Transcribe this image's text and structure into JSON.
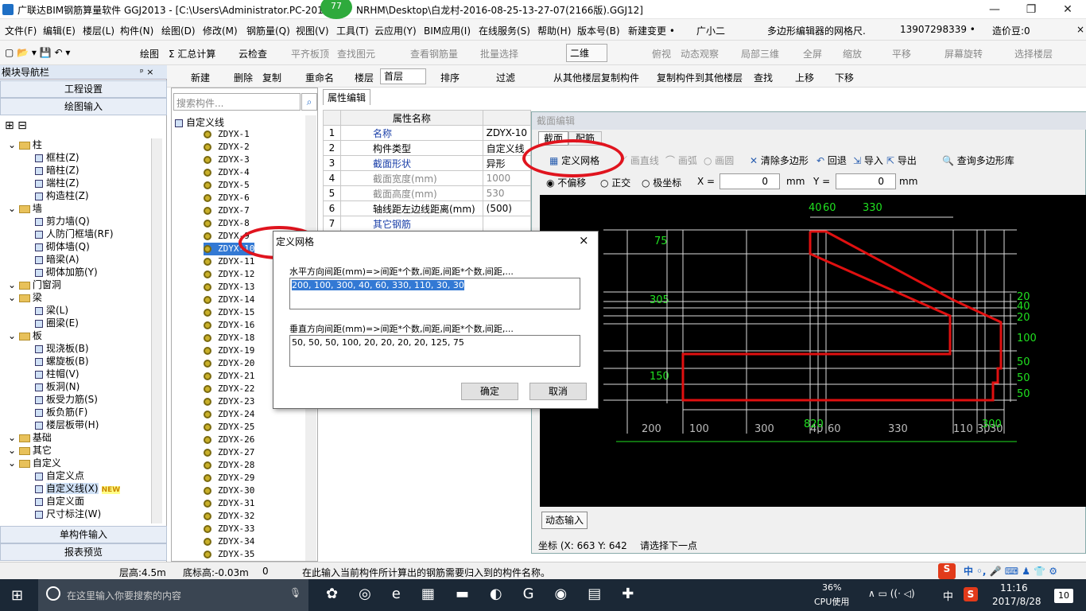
{
  "window": {
    "title": "广联达BIM钢筋算量软件 GGJ2013 - [C:\\Users\\Administrator.PC-201",
    "title_rest": "NRHM\\Desktop\\白龙村-2016-08-25-13-27-07(2166版).GGJ12]",
    "badge": "77"
  },
  "menu": [
    "文件(F)",
    "编辑(E)",
    "楼层(L)",
    "构件(N)",
    "绘图(D)",
    "修改(M)",
    "钢筋量(Q)",
    "视图(V)",
    "工具(T)",
    "云应用(Y)",
    "BIM应用(I)",
    "在线服务(S)",
    "帮助(H)",
    "版本号(B)",
    "新建变更 •",
    "广小二",
    "多边形编辑器的网格尺.",
    "13907298339 •",
    "造价豆:0"
  ],
  "toolbar1": [
    "绘图",
    "Σ 汇总计算",
    "云检查",
    "平齐板顶",
    "查找图元",
    "查看钢筋量",
    "批量选择",
    "二维",
    "俯视",
    "动态观察",
    "局部三维",
    "全屏",
    "缩放",
    "平移",
    "屏幕旋转",
    "选择楼层"
  ],
  "toolbar2": [
    "新建",
    "删除",
    "复制",
    "重命名",
    "楼层",
    "首层",
    "排序",
    "过滤",
    "从其他楼层复制构件",
    "复制构件到其他楼层",
    "查找",
    "上移",
    "下移"
  ],
  "nav": {
    "title": "模块导航栏",
    "pin": "ᵖ ×",
    "top_buttons": [
      "工程设置",
      "绘图输入"
    ],
    "bottom_buttons": [
      "单构件输入",
      "报表预览"
    ],
    "tree": [
      {
        "label": "柱",
        "level": 0,
        "type": "folder"
      },
      {
        "label": "框柱(Z)",
        "level": 1
      },
      {
        "label": "暗柱(Z)",
        "level": 1
      },
      {
        "label": "端柱(Z)",
        "level": 1
      },
      {
        "label": "构造柱(Z)",
        "level": 1
      },
      {
        "label": "墙",
        "level": 0,
        "type": "folder"
      },
      {
        "label": "剪力墙(Q)",
        "level": 1
      },
      {
        "label": "人防门框墙(RF)",
        "level": 1
      },
      {
        "label": "砌体墙(Q)",
        "level": 1
      },
      {
        "label": "暗梁(A)",
        "level": 1
      },
      {
        "label": "砌体加筋(Y)",
        "level": 1
      },
      {
        "label": "门窗洞",
        "level": 0,
        "type": "folder"
      },
      {
        "label": "梁",
        "level": 0,
        "type": "folder"
      },
      {
        "label": "梁(L)",
        "level": 1
      },
      {
        "label": "圈梁(E)",
        "level": 1
      },
      {
        "label": "板",
        "level": 0,
        "type": "folder"
      },
      {
        "label": "现浇板(B)",
        "level": 1
      },
      {
        "label": "螺旋板(B)",
        "level": 1
      },
      {
        "label": "柱帽(V)",
        "level": 1
      },
      {
        "label": "板洞(N)",
        "level": 1
      },
      {
        "label": "板受力筋(S)",
        "level": 1
      },
      {
        "label": "板负筋(F)",
        "level": 1
      },
      {
        "label": "楼层板带(H)",
        "level": 1
      },
      {
        "label": "基础",
        "level": 0,
        "type": "folder"
      },
      {
        "label": "其它",
        "level": 0,
        "type": "folder"
      },
      {
        "label": "自定义",
        "level": 0,
        "type": "folder"
      },
      {
        "label": "自定义点",
        "level": 1
      },
      {
        "label": "自定义线(X)",
        "level": 1,
        "badge": "NEW"
      },
      {
        "label": "自定义面",
        "level": 1
      },
      {
        "label": "尺寸标注(W)",
        "level": 1
      }
    ]
  },
  "components": {
    "search_placeholder": "搜索构件...",
    "root": "自定义线",
    "items": [
      "ZDYX-1",
      "ZDYX-2",
      "ZDYX-3",
      "ZDYX-4",
      "ZDYX-5",
      "ZDYX-6",
      "ZDYX-7",
      "ZDYX-8",
      "ZDYX-9",
      "ZDYX-10",
      "ZDYX-11",
      "ZDYX-12",
      "ZDYX-13",
      "ZDYX-14",
      "ZDYX-15",
      "ZDYX-16",
      "ZDYX-18",
      "ZDYX-19",
      "ZDYX-20",
      "ZDYX-21",
      "ZDYX-22",
      "ZDYX-23",
      "ZDYX-24",
      "ZDYX-25",
      "ZDYX-26",
      "ZDYX-27",
      "ZDYX-28",
      "ZDYX-29",
      "ZDYX-30",
      "ZDYX-31",
      "ZDYX-32",
      "ZDYX-33",
      "ZDYX-34",
      "ZDYX-35"
    ],
    "selected": "ZDYX-10"
  },
  "props": {
    "tab": "属性编辑",
    "header": "属性名称",
    "rows": [
      {
        "n": "1",
        "name": "名称",
        "val": "ZDYX-10",
        "blue": true
      },
      {
        "n": "2",
        "name": "构件类型",
        "val": "自定义线",
        "blue": false
      },
      {
        "n": "3",
        "name": "截面形状",
        "val": "异形",
        "blue": true
      },
      {
        "n": "4",
        "name": "截面宽度(mm)",
        "val": "1000",
        "gray": true
      },
      {
        "n": "5",
        "name": "截面高度(mm)",
        "val": "530",
        "gray": true
      },
      {
        "n": "6",
        "name": "轴线距左边线距离(mm)",
        "val": "(500)",
        "blue": false
      },
      {
        "n": "7",
        "name": "其它钢筋",
        "val": "",
        "blue": true
      }
    ]
  },
  "section": {
    "title": "截面编辑",
    "tabs": [
      "截面",
      "配筋"
    ],
    "tools": [
      "定义网格",
      "画直线",
      "画弧",
      "画圆",
      "清除多边形",
      "回退",
      "导入",
      "导出",
      "查询多边形库"
    ],
    "modes": [
      "不偏移",
      "正交",
      "极坐标"
    ],
    "x_label": "X =",
    "x_val": "0",
    "y_label": "Y =",
    "y_val": "0",
    "unit": "mm",
    "dyn_input": "动态输入",
    "coord": "坐标 (X: 663 Y: 642",
    "prompt": "请选择下一点",
    "dims_top": [
      "40",
      "60",
      "330"
    ],
    "dims_left": [
      "75",
      "305",
      "150"
    ],
    "dims_right": [
      "20",
      "40",
      "20",
      "100",
      "50",
      "50",
      "50"
    ],
    "dims_bottom": [
      "200",
      "100",
      "300",
      "40",
      "60",
      "330",
      "110",
      "30",
      "30"
    ],
    "dims_mid": [
      "820",
      "300"
    ]
  },
  "dialog": {
    "title": "定义网格",
    "close": "×",
    "h_label": "水平方向间距(mm)=>间距*个数,间距,间距*个数,间距,...",
    "h_value": "200, 100, 300, 40, 60, 330, 110, 30, 30",
    "v_label": "垂直方向间距(mm)=>间距*个数,间距,间距*个数,间距,...",
    "v_value": "50, 50, 50, 100, 20, 20, 20, 20, 125, 75",
    "ok": "确定",
    "cancel": "取消"
  },
  "status": {
    "floor_h": "层高:4.5m",
    "base_h": "底标高:-0.03m",
    "zero": "0",
    "msg": "在此输入当前构件所计算出的钢筋需要归入到的构件名称。"
  },
  "taskbar": {
    "search": "在这里输入你要搜索的内容",
    "cpu_pct": "36%",
    "cpu_label": "CPU使用",
    "time": "11:16",
    "date": "2017/8/28",
    "ime": "中",
    "notif": "10"
  }
}
